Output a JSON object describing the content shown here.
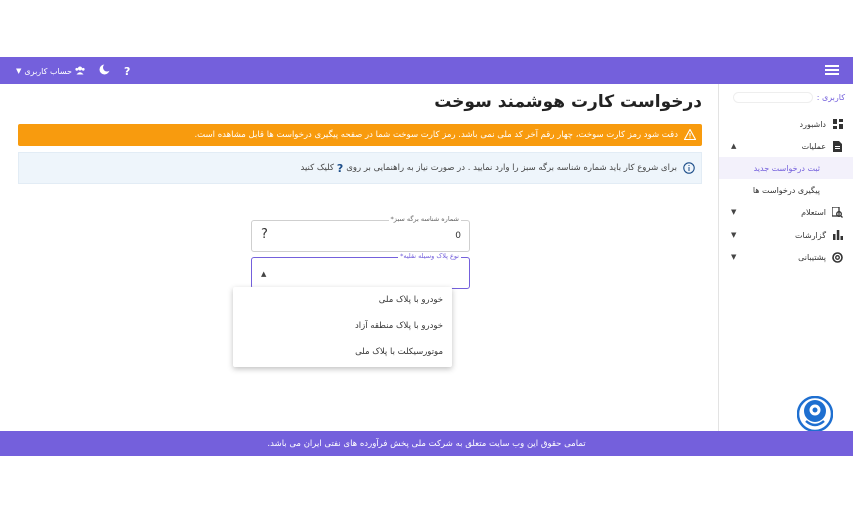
{
  "topbar": {
    "account_label": "حساب کاربری",
    "help_icon": "?",
    "icons": [
      "chevron-down-icon",
      "user-group-icon",
      "moon-icon",
      "help-icon",
      "hamburger-icon"
    ]
  },
  "sidebar": {
    "user_label": "کاربری :",
    "items": [
      {
        "label": "داشبورد",
        "icon": "dashboard-icon"
      },
      {
        "label": "عملیات",
        "icon": "document-icon"
      },
      {
        "label": "ثبت درخواست جدید"
      },
      {
        "label": "پیگیری درخواست ها"
      },
      {
        "label": "استعلام",
        "icon": "search-doc-icon"
      },
      {
        "label": "گزارشات",
        "icon": "bar-chart-icon"
      },
      {
        "label": "پشتیبانی",
        "icon": "support-icon"
      }
    ]
  },
  "main": {
    "title": "درخواست کارت هوشمند سوخت",
    "warning": "دقت شود رمز کارت سوخت، چهار رقم آخر کد ملی نمی باشد. رمز کارت سوخت شما در صفحه پیگیری درخواست ها قابل مشاهده است.",
    "info_before": "برای شروع کار باید شماره شناسه برگه سبز را وارد نمایید . در صورت نیاز به راهنمایی بر روی",
    "info_q": "?",
    "info_after": "کلیک کنید",
    "green_sheet": {
      "label": "شماره شناسه برگه سبز*",
      "value": "0",
      "help": "?"
    },
    "plate_type": {
      "label": "نوع پلاک وسیله نقلیه*",
      "options": [
        "خودرو با پلاک ملی",
        "خودرو با پلاک منطقه آزاد",
        "موتورسیکلت با پلاک ملی"
      ]
    }
  },
  "footer": {
    "text": "تمامی حقوق این وب سایت متعلق به شرکت ملی پخش فرآورده های نفتی ایران می باشد."
  },
  "colors": {
    "brand": "#7460dc",
    "warning": "#f89b0e",
    "info_bg": "#eef5fb"
  }
}
